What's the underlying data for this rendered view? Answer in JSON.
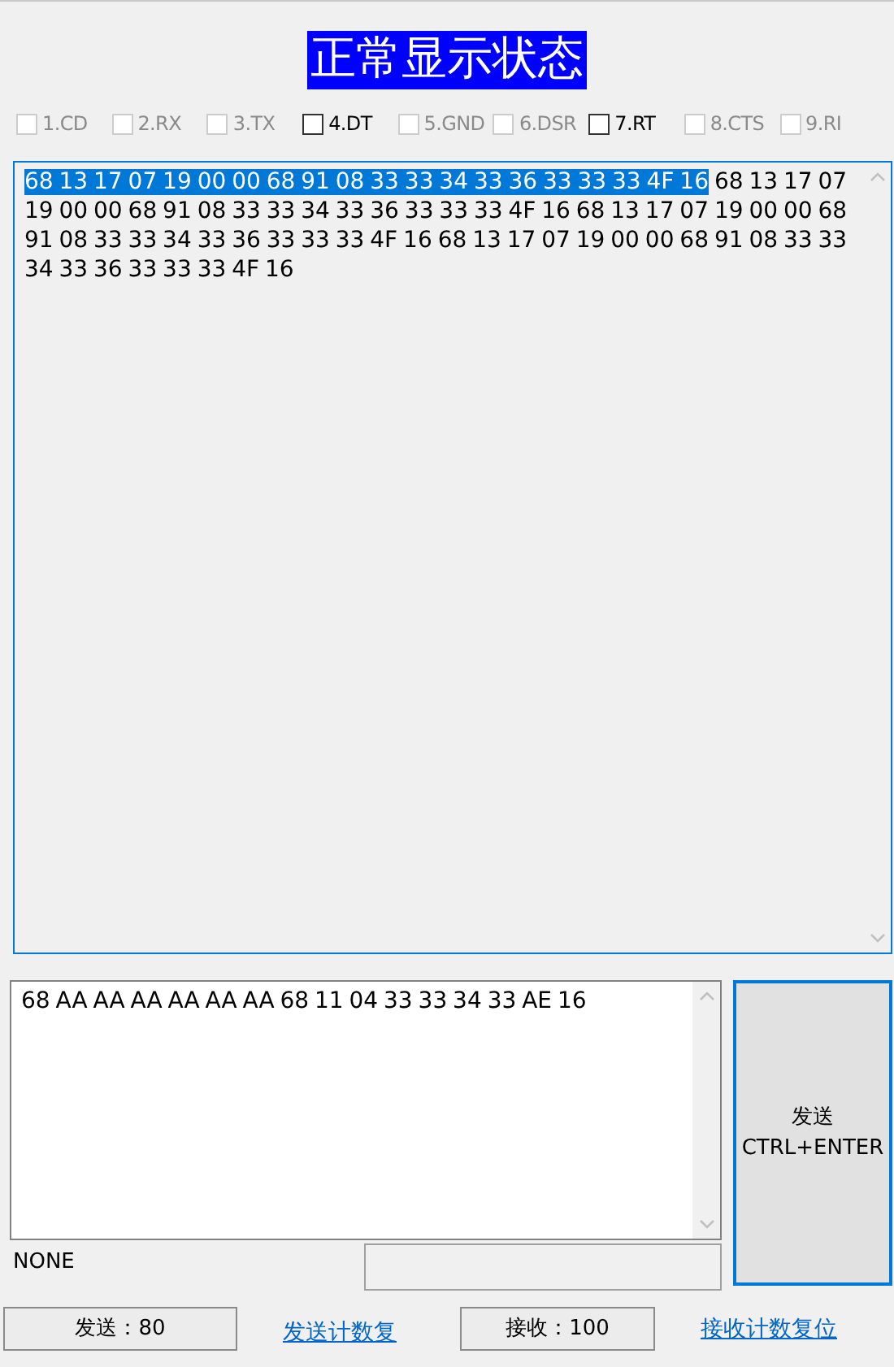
{
  "title": "正常显示状态",
  "signals": [
    {
      "label": "1.CD",
      "checked": false,
      "disabled": true
    },
    {
      "label": "2.RX",
      "checked": false,
      "disabled": true
    },
    {
      "label": "3.TX",
      "checked": false,
      "disabled": true
    },
    {
      "label": "4.DT",
      "checked": false,
      "disabled": false
    },
    {
      "label": "5.GND",
      "checked": false,
      "disabled": true
    },
    {
      "label": "6.DSR",
      "checked": false,
      "disabled": true
    },
    {
      "label": "7.RT",
      "checked": false,
      "disabled": false
    },
    {
      "label": "8.CTS",
      "checked": false,
      "disabled": true
    },
    {
      "label": "9.RI",
      "checked": false,
      "disabled": true
    }
  ],
  "receive": {
    "selected_text": "68 13 17 07 19 00 00 68 91 08 33 33 34 33 36 33 33 33 4F 16",
    "text": "68 13 17 07 19 00 00 68 91 08 33 33 34 33 36 33 33 33 4F 16 68 13 17 07 19 00 00 68 91 08 33 33 34 33 36 33 33 33 4F 16 68 13 17 07 19 00 00 68 91 08 33 33 34 33 36 33 33 33 4F 16"
  },
  "send": {
    "value": "68 AA AA AA AA AA AA 68 11 04 33 33 34 33 AE 16"
  },
  "send_button": {
    "line_1": "发送",
    "line_2": "CTRL+ENTER"
  },
  "status": "NONE",
  "sent_count": "发送：80",
  "reset_sent_link": "发送计数复",
  "received_count": "接收：100",
  "reset_received_link": "接收计数复位"
}
